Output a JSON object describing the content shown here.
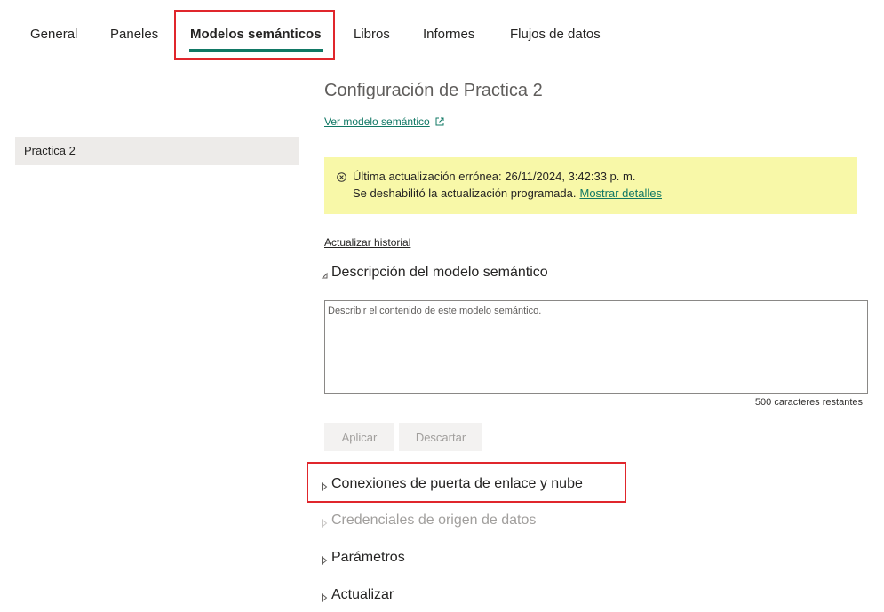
{
  "tabs": [
    {
      "label": "General"
    },
    {
      "label": "Paneles"
    },
    {
      "label": "Modelos semánticos"
    },
    {
      "label": "Libros"
    },
    {
      "label": "Informes"
    },
    {
      "label": "Flujos de datos"
    }
  ],
  "active_tab": "Modelos semánticos",
  "sidebar": {
    "items": [
      {
        "label": "Practica 2"
      }
    ]
  },
  "main": {
    "title": "Configuración de Practica 2",
    "view_model_link": "Ver modelo semántico",
    "banner": {
      "line1": "Última actualización errónea: 26/11/2024, 3:42:33 p. m.",
      "line2": "Se deshabilitó la actualización programada.",
      "details_link": "Mostrar detalles"
    },
    "history_link": "Actualizar historial",
    "description": {
      "header": "Descripción del modelo semántico",
      "placeholder": "Describir el contenido de este modelo semántico.",
      "remaining": "500 caracteres restantes",
      "apply_label": "Aplicar",
      "discard_label": "Descartar"
    },
    "sections": [
      {
        "label": "Conexiones de puerta de enlace y nube"
      },
      {
        "label": "Credenciales de origen de datos"
      },
      {
        "label": "Parámetros"
      },
      {
        "label": "Actualizar"
      }
    ]
  },
  "colors": {
    "accent": "#117865",
    "highlight": "#e0262c",
    "banner_bg": "#f8f8a8",
    "sidebar_selected": "#edebe9"
  },
  "icons": [
    "open-external-icon",
    "error-circle-icon",
    "caret-expanded-icon",
    "caret-collapsed-icon"
  ]
}
